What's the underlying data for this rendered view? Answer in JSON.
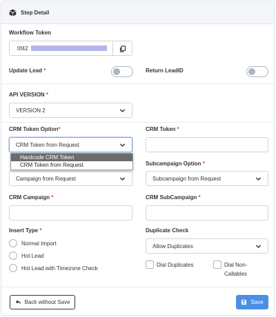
{
  "header": {
    "title": "Step Detail",
    "icon": "cube-icon"
  },
  "workflow_token": {
    "label": "Workflow Token",
    "value_prefix": "0f42",
    "copy_icon": "copy-icon"
  },
  "update_lead": {
    "label": "Update Lead",
    "required": "*",
    "toggle_on": false
  },
  "return_leadid": {
    "label": "Return LeadID",
    "toggle_on": false
  },
  "api_version": {
    "label": "API VERSION",
    "required": "*",
    "value": "VERSION 2"
  },
  "crm_token_option": {
    "label": "CRM Token Option",
    "required": "*",
    "value": "CRM Token from Request",
    "options": [
      "Hardcode CRM Token",
      "CRM Token from Request"
    ],
    "highlighted": "Hardcode CRM Token"
  },
  "crm_token": {
    "label": "CRM Token",
    "required": "*",
    "value": ""
  },
  "campaign_option": {
    "value": "Campaign from Request"
  },
  "subcampaign_option": {
    "label": "Subcampaign Option",
    "required": "*",
    "value": "Subcampaign from Request"
  },
  "crm_campaign": {
    "label": "CRM Campaign",
    "required": "*",
    "value": ""
  },
  "crm_subcampaign": {
    "label": "CRM SubCampaign",
    "required": "*",
    "value": ""
  },
  "insert_type": {
    "label": "Insert Type",
    "required": "*",
    "options": [
      "Normal Import",
      "Hot Lead",
      "Hot Lead with Timezone Check"
    ]
  },
  "duplicate_check": {
    "label": "Duplicate Check",
    "value": "Allow Duplicates",
    "checkbox_1": "Dial Duplicates",
    "checkbox_2_line1": "Dial Non-",
    "checkbox_2_line2": "Callables"
  },
  "buttons": {
    "back": "Back without Save",
    "save": "Save"
  },
  "colors": {
    "primary": "#4a90e2",
    "required": "#e53e3e",
    "token_mask": "#b4b6ea"
  }
}
